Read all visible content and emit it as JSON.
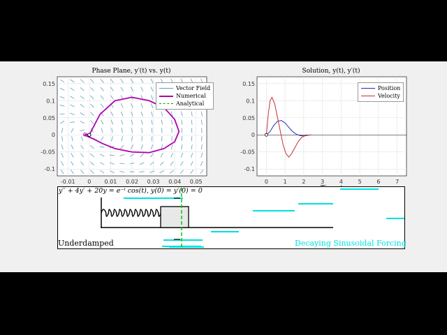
{
  "phase": {
    "title": "Phase Plane, y′(t) vs. y(t)",
    "legend": [
      "Vector Field",
      "Numerical",
      "Analytical"
    ],
    "xticks": [
      "-0.01",
      "0",
      "0.01",
      "0.02",
      "0.03",
      "0.04",
      "0.05"
    ],
    "yticks": [
      "0.15",
      "0.1",
      "0.05",
      "0",
      "-0.05",
      "-0.1"
    ],
    "colors": {
      "field": "#5aa0b8",
      "numerical": "#b000b0",
      "analytical": "#00aa00"
    }
  },
  "solution": {
    "title": "Solution, y(t), y′(t)",
    "legend": [
      "Position",
      "Velocity"
    ],
    "xticks": [
      "0",
      "1",
      "2",
      "3",
      "4",
      "5",
      "6",
      "7"
    ],
    "yticks": [
      "0.15",
      "0.1",
      "0.05",
      "0",
      "-0.05",
      "-0.1"
    ],
    "xlabel": "Time, t",
    "colors": {
      "position": "#1f2fa8",
      "velocity": "#c83030"
    }
  },
  "animation": {
    "equation": "y′′ + 4y′ + 20y = e⁻ᵗ cos(t),    y(0) = y′(0) = 0",
    "damping_label": "Underdamped",
    "forcing_label": "Decaying Sinusoidal Forcing",
    "forcing_color": "#00e0e0",
    "marker_color": "#00cc00"
  },
  "chart_data": [
    {
      "type": "line",
      "title": "Phase Plane, y′(t) vs. y(t)",
      "xlim": [
        -0.015,
        0.055
      ],
      "ylim": [
        -0.12,
        0.17
      ],
      "series": [
        {
          "name": "Numerical",
          "x": [
            0,
            0.005,
            0.012,
            0.02,
            0.028,
            0.035,
            0.04,
            0.042,
            0.04,
            0.035,
            0.028,
            0.02,
            0.012,
            0.006,
            0.002,
            -0.001,
            -0.002,
            -0.001,
            0
          ],
          "y": [
            0,
            0.06,
            0.1,
            0.11,
            0.1,
            0.08,
            0.045,
            0.01,
            -0.02,
            -0.04,
            -0.052,
            -0.05,
            -0.04,
            -0.025,
            -0.012,
            -0.004,
            0,
            0.002,
            0
          ]
        },
        {
          "name": "Analytical",
          "x": [],
          "y": []
        }
      ]
    },
    {
      "type": "line",
      "title": "Solution, y(t), y′(t)",
      "xlabel": "Time, t",
      "xlim": [
        -0.5,
        7.5
      ],
      "ylim": [
        -0.12,
        0.17
      ],
      "series": [
        {
          "name": "Position",
          "x": [
            0,
            0.2,
            0.4,
            0.6,
            0.8,
            1.0,
            1.2,
            1.4,
            1.6,
            1.8,
            2.0,
            2.2,
            2.4
          ],
          "y": [
            0,
            0.01,
            0.028,
            0.04,
            0.042,
            0.035,
            0.022,
            0.01,
            0.002,
            -0.002,
            -0.003,
            -0.001,
            0
          ]
        },
        {
          "name": "Velocity",
          "x": [
            0,
            0.1,
            0.2,
            0.3,
            0.45,
            0.6,
            0.75,
            0.9,
            1.05,
            1.2,
            1.35,
            1.5,
            1.7,
            1.9,
            2.1,
            2.4
          ],
          "y": [
            0,
            0.06,
            0.1,
            0.11,
            0.09,
            0.05,
            0.01,
            -0.03,
            -0.055,
            -0.065,
            -0.055,
            -0.04,
            -0.02,
            -0.007,
            -0.002,
            0
          ]
        }
      ]
    }
  ]
}
